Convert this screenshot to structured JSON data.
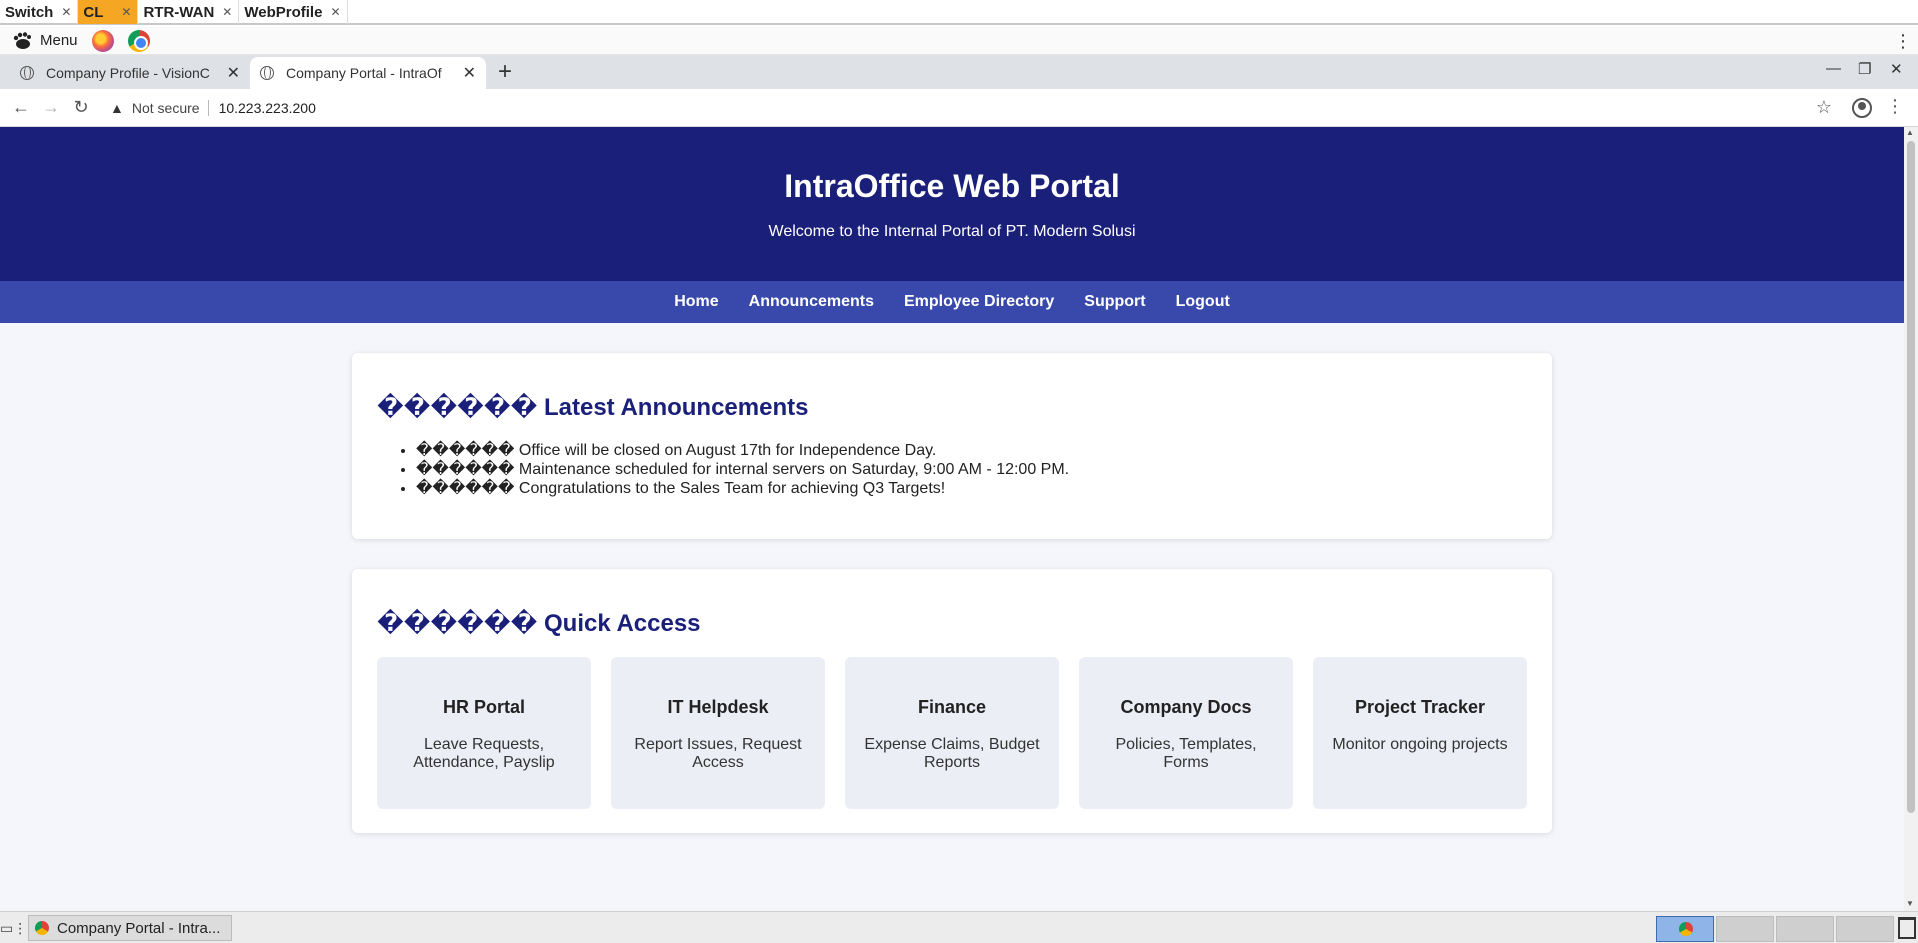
{
  "vnc_tabs": [
    {
      "label": "Switch",
      "active": false
    },
    {
      "label": "CL",
      "active": true
    },
    {
      "label": "RTR-WAN",
      "active": false
    },
    {
      "label": "WebProfile",
      "active": false
    }
  ],
  "desktop": {
    "menu_label": "Menu",
    "taskbar_window_title": "Company Portal - Intra..."
  },
  "browser": {
    "tabs": [
      {
        "title": "Company Profile - VisionC",
        "active": false
      },
      {
        "title": "Company Portal - IntraOf",
        "active": true
      }
    ],
    "security_label": "Not secure",
    "url": "10.223.223.200"
  },
  "page": {
    "header_title": "IntraOffice Web Portal",
    "header_subtitle": "Welcome to the Internal Portal of PT. Modern Solusi",
    "nav": [
      "Home",
      "Announcements",
      "Employee Directory",
      "Support",
      "Logout"
    ],
    "announcements": {
      "glyphs": "������",
      "title": "Latest Announcements",
      "items": [
        {
          "glyphs": "������",
          "text": "Office will be closed on August 17th for Independence Day."
        },
        {
          "glyphs": "������",
          "text": "Maintenance scheduled for internal servers on Saturday, 9:00 AM - 12:00 PM."
        },
        {
          "glyphs": "������",
          "text": "Congratulations to the Sales Team for achieving Q3 Targets!"
        }
      ]
    },
    "quick_access": {
      "glyphs": "������",
      "title": "Quick Access",
      "items": [
        {
          "title": "HR Portal",
          "desc": "Leave Requests, Attendance, Payslip"
        },
        {
          "title": "IT Helpdesk",
          "desc": "Report Issues, Request Access"
        },
        {
          "title": "Finance",
          "desc": "Expense Claims, Budget Reports"
        },
        {
          "title": "Company Docs",
          "desc": "Policies, Templates, Forms"
        },
        {
          "title": "Project Tracker",
          "desc": "Monitor ongoing projects"
        }
      ]
    }
  },
  "colors": {
    "header_bg": "#1a1f7a",
    "nav_bg": "#3949ab",
    "active_vnc_tab": "#f5a623"
  }
}
